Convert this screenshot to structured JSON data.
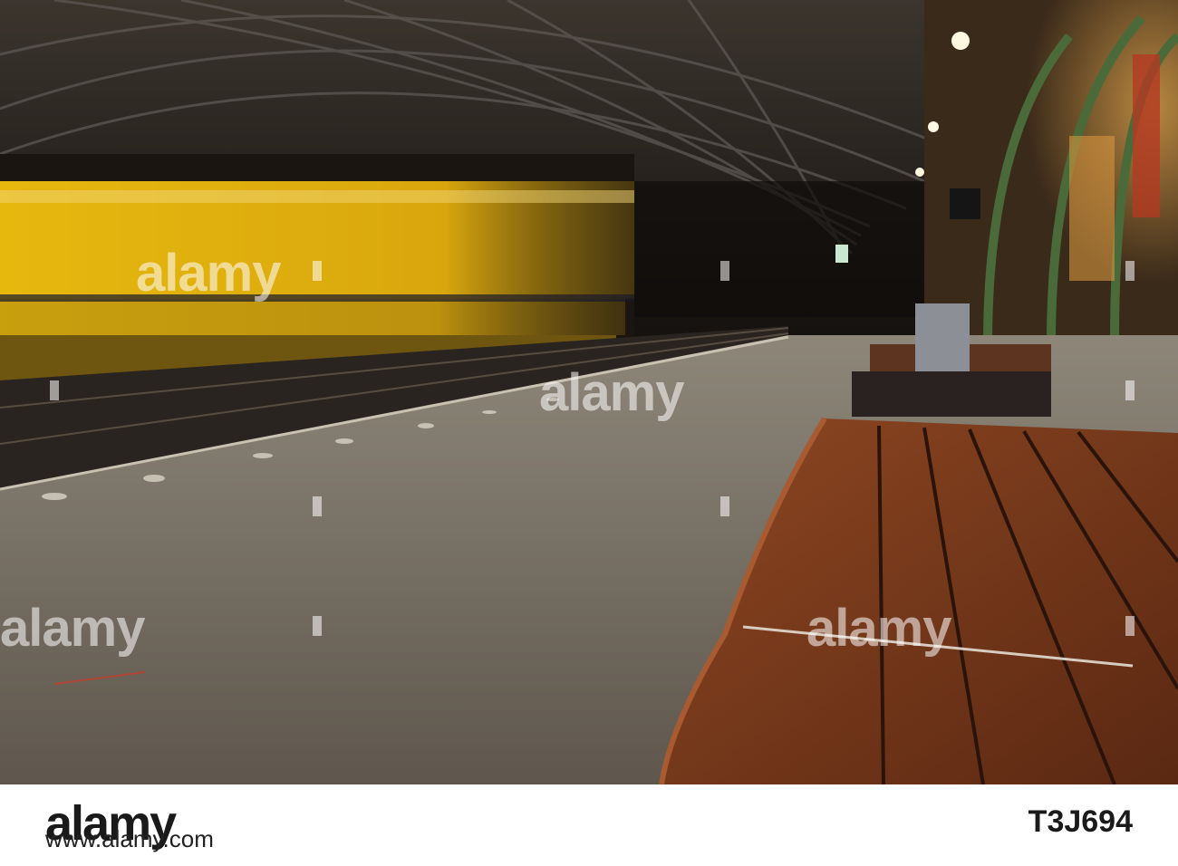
{
  "watermark": {
    "text": "alamy"
  },
  "footer": {
    "logo": "alamy",
    "image_id": "T3J694",
    "url": "www.alamy.com"
  },
  "colors": {
    "train_yellow": "#e2b20e",
    "bench_wood": "#7a3a1c",
    "platform": "#7b7366",
    "roof": "#2a2420",
    "warm_light": "#d89a3a"
  }
}
